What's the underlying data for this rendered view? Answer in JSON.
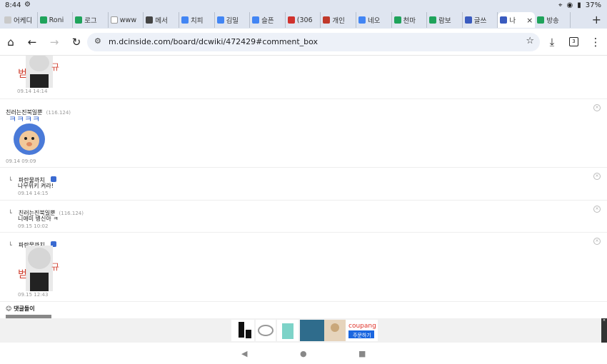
{
  "status": {
    "time": "8:44",
    "battery": "37%"
  },
  "tabs": [
    {
      "label": "어케디",
      "icon_color": "#c9c9c9"
    },
    {
      "label": "Roni",
      "icon_color": "#1fa35b"
    },
    {
      "label": "로그",
      "icon_color": "#1fa35b"
    },
    {
      "label": "www",
      "icon_color": "#ffffff"
    },
    {
      "label": "메서",
      "icon_color": "#444444"
    },
    {
      "label": "치피",
      "icon_color": "#4285f4"
    },
    {
      "label": "김밀",
      "icon_color": "#4285f4"
    },
    {
      "label": "슬픈",
      "icon_color": "#4285f4"
    },
    {
      "label": "(306",
      "icon_color": "#d0312d"
    },
    {
      "label": "개인",
      "icon_color": "#c0392b"
    },
    {
      "label": "네오",
      "icon_color": "#4285f4"
    },
    {
      "label": "천마",
      "icon_color": "#1fa35b"
    },
    {
      "label": "람보",
      "icon_color": "#1fa35b"
    },
    {
      "label": "글쓰",
      "icon_color": "#3a5bbf"
    },
    {
      "label": "나",
      "icon_color": "#3a5bbf",
      "active": true
    },
    {
      "label": "방송",
      "icon_color": "#1fa35b"
    }
  ],
  "url": "m.dcinside.com/board/dcwiki/472429#comment_box",
  "tab_count": "3",
  "comments": [
    {
      "date": "09.14 14:14"
    },
    {
      "author": "친러는진북일뿐",
      "ip": "(116.124)",
      "date": "09.14 09:09",
      "sticker": "ㅋㅋㅋㅋ"
    },
    {
      "author": "파란물까치",
      "body": "나무위키 켜라!",
      "date": "09.14 14:15"
    },
    {
      "author": "친러는진북일뿐",
      "ip": "(116.124)",
      "body": "니애미 병신아 ㅋ",
      "date": "09.15 10:02"
    },
    {
      "author": "파란물까치",
      "date": "09.15 12:43"
    }
  ],
  "comment_bot_label": "댓글돌이",
  "ad": {
    "brand": "coupang",
    "button": "주문하기"
  },
  "icons": [
    "home-icon",
    "back-icon",
    "forward-icon",
    "reload-icon",
    "star-icon",
    "download-icon",
    "menu-icon"
  ]
}
